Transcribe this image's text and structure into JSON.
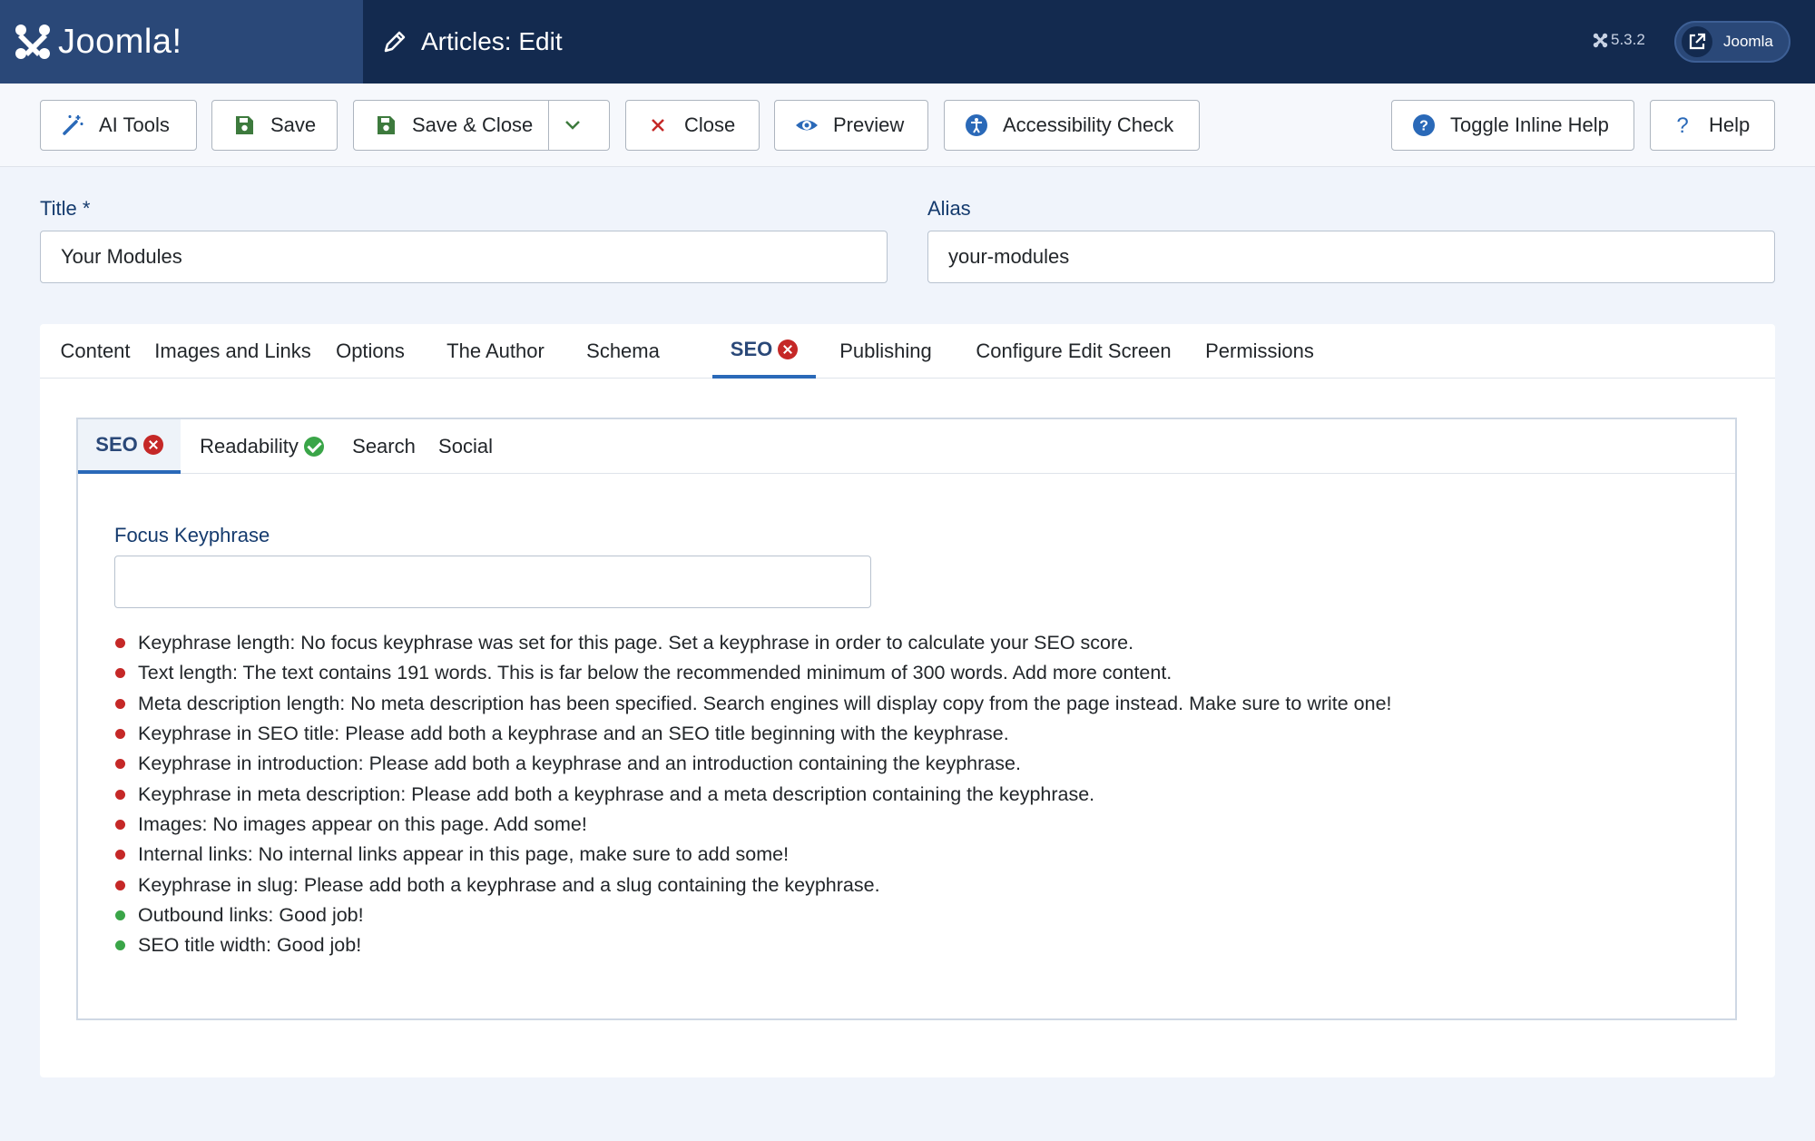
{
  "header": {
    "logo_text": "Joomla!",
    "page_title": "Articles: Edit",
    "version": "5.3.2",
    "site_button_label": "Joomla"
  },
  "toolbar": {
    "ai_tools": "AI Tools",
    "save": "Save",
    "save_close": "Save & Close",
    "close": "Close",
    "preview": "Preview",
    "accessibility_check": "Accessibility Check",
    "toggle_inline_help": "Toggle Inline Help",
    "help": "Help"
  },
  "form": {
    "title_label": "Title *",
    "title_value": "Your Modules",
    "alias_label": "Alias",
    "alias_value": "your-modules"
  },
  "tabs": [
    {
      "label": "Content"
    },
    {
      "label": "Images and Links"
    },
    {
      "label": "Options"
    },
    {
      "label": "The Author"
    },
    {
      "label": "Schema"
    },
    {
      "label": "SEO",
      "status": "error",
      "active": true
    },
    {
      "label": "Publishing"
    },
    {
      "label": "Configure Edit Screen"
    },
    {
      "label": "Permissions"
    }
  ],
  "seo_tabs": [
    {
      "label": "SEO",
      "status": "error",
      "active": true
    },
    {
      "label": "Readability",
      "status": "ok"
    },
    {
      "label": "Search"
    },
    {
      "label": "Social"
    }
  ],
  "focus_keyphrase": {
    "label": "Focus Keyphrase",
    "value": ""
  },
  "results": [
    {
      "status": "bad",
      "text": "Keyphrase length: No focus keyphrase was set for this page. Set a keyphrase in order to calculate your SEO score."
    },
    {
      "status": "bad",
      "text": "Text length: The text contains 191 words. This is far below the recommended minimum of 300 words. Add more content."
    },
    {
      "status": "bad",
      "text": "Meta description length: No meta description has been specified. Search engines will display copy from the page instead. Make sure to write one!"
    },
    {
      "status": "bad",
      "text": "Keyphrase in SEO title: Please add both a keyphrase and an SEO title beginning with the keyphrase."
    },
    {
      "status": "bad",
      "text": "Keyphrase in introduction: Please add both a keyphrase and an introduction containing the keyphrase."
    },
    {
      "status": "bad",
      "text": "Keyphrase in meta description: Please add both a keyphrase and a meta description containing the keyphrase."
    },
    {
      "status": "bad",
      "text": "Images: No images appear on this page. Add some!"
    },
    {
      "status": "bad",
      "text": "Internal links: No internal links appear in this page, make sure to add some!"
    },
    {
      "status": "bad",
      "text": "Keyphrase in slug: Please add both a keyphrase and a slug containing the keyphrase."
    },
    {
      "status": "good",
      "text": "Outbound links: Good job!"
    },
    {
      "status": "good",
      "text": "SEO title width: Good job!"
    }
  ],
  "colors": {
    "header_bg": "#132a4f",
    "logo_bg": "#2a4878",
    "bad": "#c52827",
    "good": "#3aa548",
    "accent": "#2a69b8"
  }
}
